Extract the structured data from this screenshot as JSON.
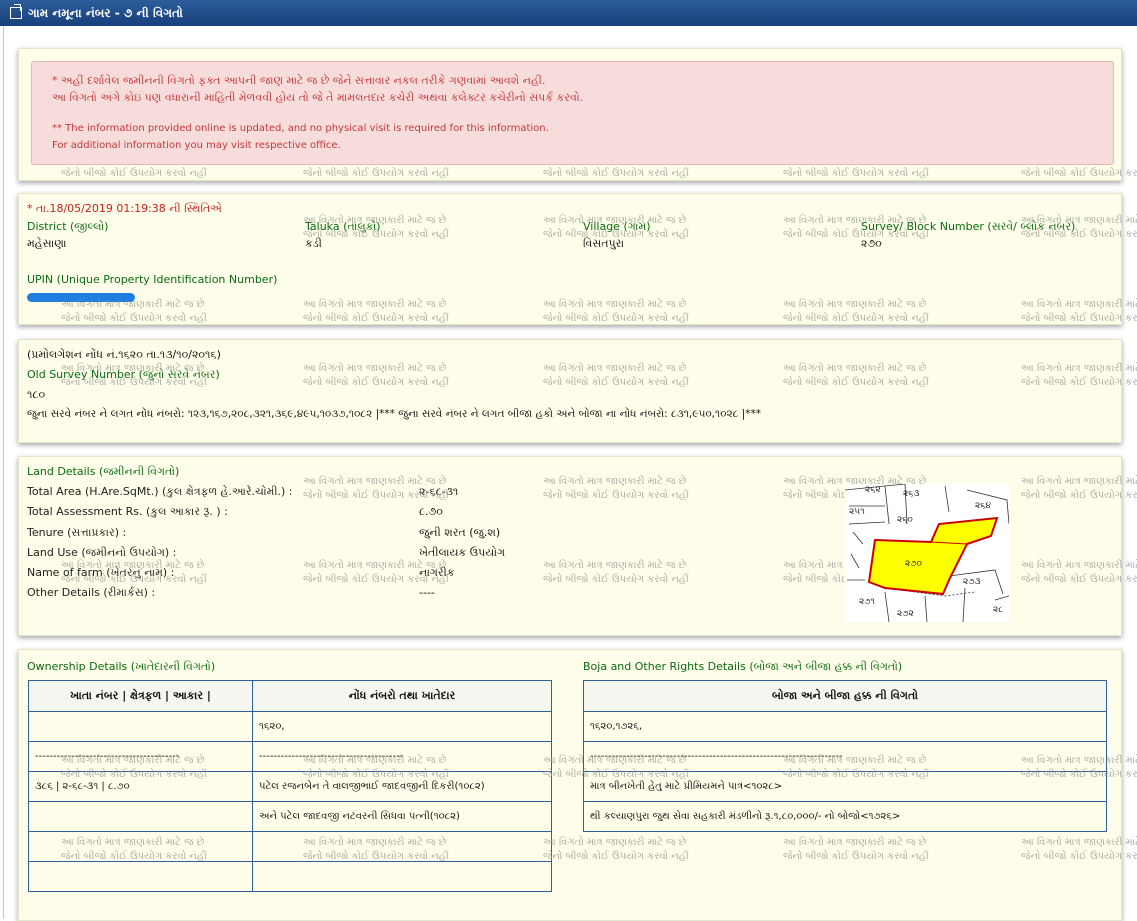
{
  "title": "ગામ નમૂના નંબર - ૭ ની વિગતો",
  "notice": {
    "gu_line1": "* અહીં દર્શાવેલ જમીનની વિગતો ફક્ત આપની જાણ માટે જ છે જેને સત્તાવાર નકલ તરીકે ગણવામાં આવશે નહીં.",
    "gu_line2": "આ વિગતો અંગે કોઇ પણ વધારાની માહિતી મેળવવી હોય તો જે તે મામલતદાર કચેરી અથવા કલેક્ટર કચેરીનો સંપર્ક કરવો.",
    "en_line1": "** The information provided online is updated, and no physical visit is required for this information.",
    "en_line2": "For additional information you may visit respective office."
  },
  "watermark": {
    "line1": "આ વિગતો માત્ર જાણકારી માટે જ છે",
    "line2": "જેનો બીજો કોઈ ઉપયોગ કરવો નહીં"
  },
  "location": {
    "status_date": "* તા.18/05/2019 01:19:38 ની સ્થિતિએ",
    "district_label": "District (જીલ્લો)",
    "district_value": "મહેસાણા",
    "taluka_label": "Taluka (તાલુકો)",
    "taluka_value": "કડી",
    "village_label": "Village (ગામ)",
    "village_value": "વિસતપુરા",
    "survey_label": "Survey/ Block Number (સરવે/ બ્લોક નંબર)",
    "survey_value": "૨૭૦",
    "upin_label": "UPIN (Unique Property Identification Number)"
  },
  "promulgation": {
    "note": "(પ્રમોલગેશન નોંધ નં.૧૬૨૦ તા.૧૩/૧૦/૨૦૧૬)",
    "old_survey_label": "Old Survey Number (જુનો સરવે નંબર)",
    "old_survey_value": "૧૮૦",
    "entries_text": "જુના સરવે નંબર ને લગત નોંધ નંબરો: ૧૨૩,૧૬૭,૨૦૮,૩૨૧,૩૬૯,૪૯૫,૧૦૩૭,૧૦૮૨ |*** જુના સરવે નંબર ને લગત બીજા હકો અને બોજા ના નોંધ નંબરો: ૮૩૧,૯૫૦,૧૦૨૮ |***"
  },
  "land": {
    "heading": "Land Details (જમીનની વિગતો)",
    "rows": [
      {
        "label": "Total Area (H.Are.SqMt.) (કુલ ક્ષેત્રફળ હે.આરે.ચોમી.) :",
        "value": "૨-૬૮-૩૧"
      },
      {
        "label": "Total Assessment Rs. (કુલ આકાર રૂ. ) :",
        "value": "૮.૭૦"
      },
      {
        "label": "Tenure (સત્તાપ્રકાર) :",
        "value": "જુની શરત (જુ.શ)"
      },
      {
        "label": "Land Use (જમીનનો ઉપયોગ) :",
        "value": "ખેતીલાયક ઉપયોગ"
      },
      {
        "label": "Name of farm (ખેતરનું નામ) :",
        "value": "નાગરીક"
      },
      {
        "label": "Other Details (રીમાર્કસ) :",
        "value": "----"
      }
    ],
    "map_labels": [
      "૨૬૨",
      "૨૬૩",
      "૨૬૪",
      "૨૫૧",
      "૨૬૦",
      "૨૭૦",
      "૨૭૩",
      "૨૭૧",
      "૨૭૨",
      "૨૮"
    ]
  },
  "ownership": {
    "heading": "Ownership Details (ખાતેદારની વિગતો)",
    "col1": "ખાતા નંબર | ક્ષેત્રફળ | આકાર |",
    "col2": "નોંધ નંબરો તથા ખાતેદાર",
    "rows": [
      {
        "c1": "",
        "c2": "૧૬૨૦,"
      },
      {
        "c1": "----------------------------------------",
        "c2": "----------------------------------------"
      },
      {
        "c1": "૩૮૬ | ૨-૬૮-૩૧ | ૮.૭૦",
        "c2": "પટેલ રજનબેન તે વાલજીભાઈ જાદવજીની દિકરી(૧૦૮૨)"
      },
      {
        "c1": "",
        "c2": "અને પટેલ જાદવજી નટવરની સિધવા પત્ની(૧૦૮૨)"
      },
      {
        "c1": "",
        "c2": ""
      },
      {
        "c1": "",
        "c2": ""
      }
    ]
  },
  "boja": {
    "heading": "Boja and Other Rights Details (બોજા અને બીજા હક્ક ની વિગતો)",
    "col": "બોજા અને બીજા હક્ક ની વિગતો",
    "rows": [
      {
        "c": "૧૬૨૦,૧૭૨૬,"
      },
      {
        "c": "----------------------------------------------------------------------"
      },
      {
        "c": "માત્ર બીનખેતી હેતુ માટે પ્રીમિયમને પાત્ર<૧૦૨૮>"
      },
      {
        "c": "થી કલ્યાણપુરા જુથ સેવા સહકારી મંડળીનો રૂ.૧,૮૦,૦૦૦/- નો બોજો<૧૭૨૬>"
      }
    ]
  },
  "colors": {
    "title_bar": "#1f4e8c",
    "panel_bg": "#fdfde9",
    "alert_bg": "#f7dcdc",
    "alert_text": "#c23a3a",
    "heading_green": "#0a6b12",
    "status_red": "#cc2020",
    "table_border": "#2f5f9c",
    "plot_fill": "#ffff00",
    "plot_border": "#cc0000"
  }
}
